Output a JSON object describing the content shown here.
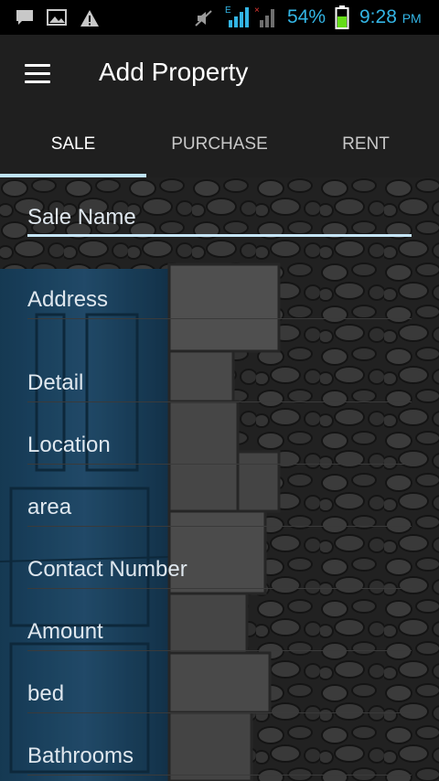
{
  "status_bar": {
    "battery_percent": "54%",
    "time": "9:28",
    "ampm": "PM",
    "icons": [
      "message-icon",
      "image-icon",
      "warning-icon",
      "mute-icon",
      "wifi-signal-icon",
      "cell-signal-icon",
      "battery-icon"
    ],
    "accent_color": "#33b5e5"
  },
  "app_bar": {
    "title": "Add Property",
    "menu_icon": "hamburger-menu-icon"
  },
  "tabs": [
    {
      "label": "SALE",
      "active": true
    },
    {
      "label": "PURCHASE",
      "active": false
    },
    {
      "label": "RENT",
      "active": false
    }
  ],
  "form": {
    "fields": [
      {
        "placeholder": "Sale Name",
        "value": ""
      },
      {
        "placeholder": "Address",
        "value": ""
      },
      {
        "placeholder": "Detail",
        "value": ""
      },
      {
        "placeholder": "Location",
        "value": ""
      },
      {
        "placeholder": "area",
        "value": ""
      },
      {
        "placeholder": "Contact Number",
        "value": ""
      },
      {
        "placeholder": "Amount",
        "value": ""
      },
      {
        "placeholder": "bed",
        "value": ""
      },
      {
        "placeholder": "Bathrooms",
        "value": ""
      }
    ]
  },
  "colors": {
    "tab_indicator": "#bfe3f7",
    "app_bar_bg": "#1f1f1f"
  }
}
